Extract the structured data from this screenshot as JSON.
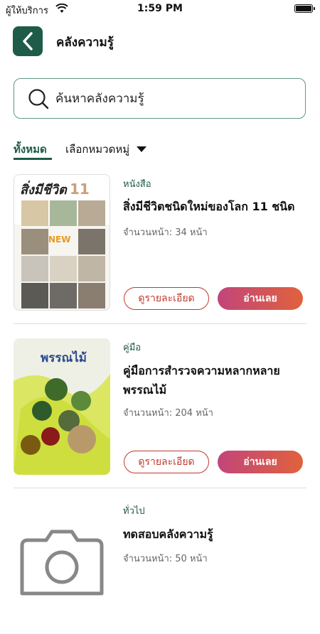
{
  "status_bar": {
    "carrier": "ผู้ให้บริการ",
    "time": "1:59 PM"
  },
  "header": {
    "title": "คลังความรู้"
  },
  "search": {
    "placeholder": "ค้นหาคลังความรู้"
  },
  "tabs": {
    "all_label": "ทั้งหมด",
    "category_label": "เลือกหมวดหมู่"
  },
  "items": [
    {
      "category": "หนังสือ",
      "title": "สิ่งมีชีวิตชนิดใหม่ของโลก 11 ชนิด",
      "pages": "จำนวนหน้า: 34 หน้า",
      "cover_text": "สิ่งมีชีวิต",
      "cover_number": "11",
      "cover_badge": "NEW",
      "detail_label": "ดูรายละเอียด",
      "read_label": "อ่านเลย"
    },
    {
      "category": "คู่มือ",
      "title": "คู่มือการสำรวจความหลากหลาย พรรณไม้",
      "pages": "จำนวนหน้า: 204 หน้า",
      "cover_title": "พรรณไม้",
      "detail_label": "ดูรายละเอียด",
      "read_label": "อ่านเลย"
    },
    {
      "category": "ทั่วไป",
      "title": "ทดสอบคลังความรู้",
      "pages": "จำนวนหน้า: 50 หน้า"
    }
  ],
  "colors": {
    "primary": "#1f5b49",
    "search_border": "#5f9a7e",
    "detail": "#c0392b",
    "read_start": "#c2457a",
    "read_end": "#e0623d"
  }
}
